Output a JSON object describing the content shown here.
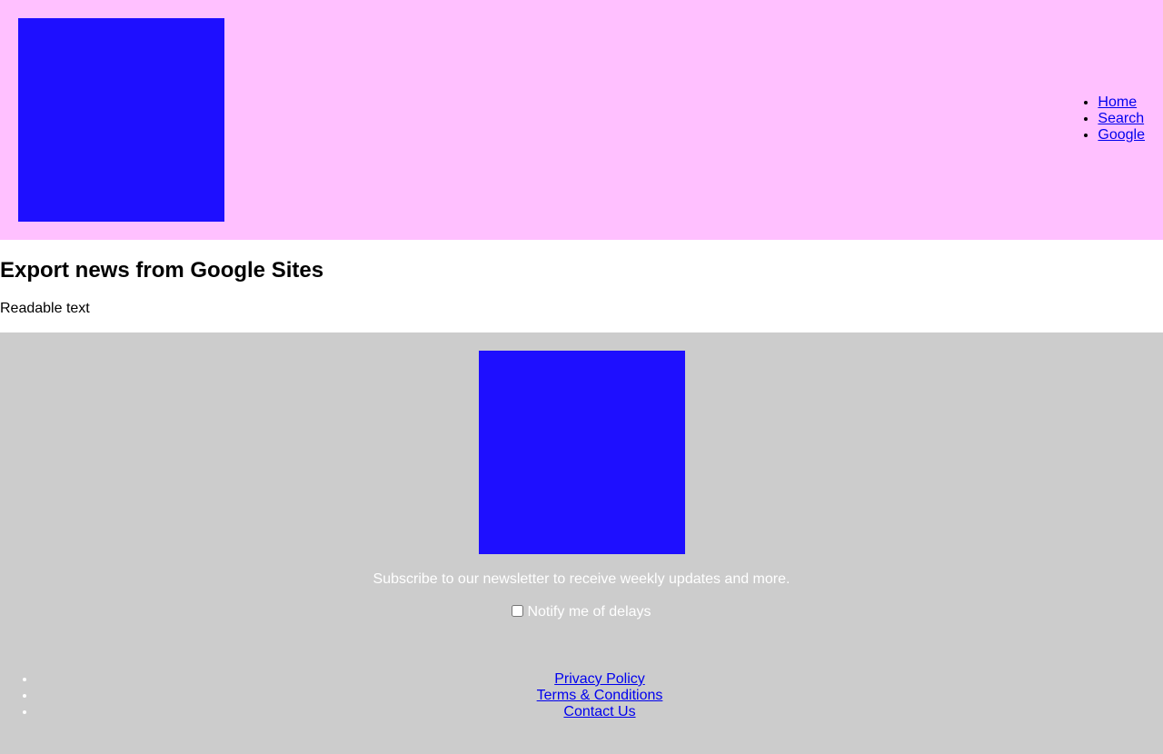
{
  "colors": {
    "header_bg": "#ffc0ff",
    "logo_fill": "#1e0fff",
    "footer_bg": "#cccccc",
    "link": "#0000ee",
    "footer_text": "#ffffff"
  },
  "header": {
    "nav": [
      {
        "label": "Home"
      },
      {
        "label": "Search"
      },
      {
        "label": "Google"
      }
    ]
  },
  "main": {
    "title": "Export news from Google Sites",
    "text": "Readable text"
  },
  "footer": {
    "newsletter_text": "Subscribe to our newsletter to receive weekly updates and more.",
    "notify_label": "Notify me of delays",
    "notify_checked": false,
    "links": [
      {
        "label": "Privacy Policy"
      },
      {
        "label": "Terms & Conditions"
      },
      {
        "label": "Contact Us"
      }
    ]
  }
}
